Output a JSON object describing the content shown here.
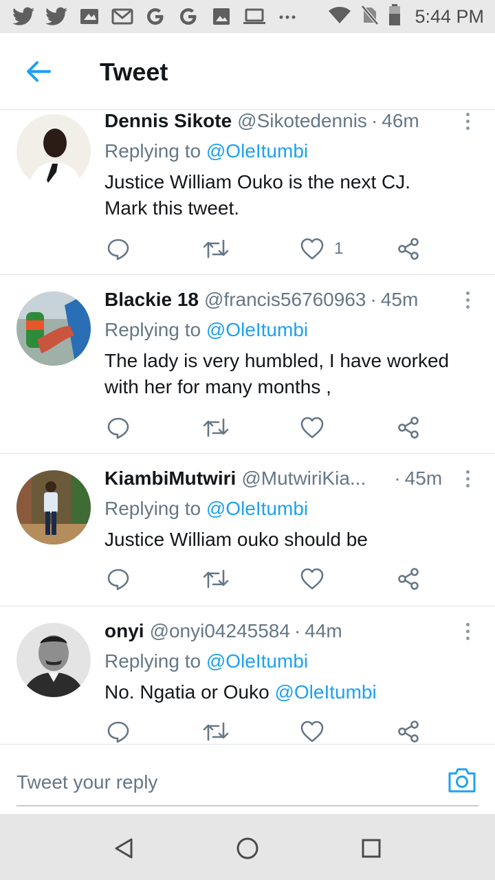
{
  "status_bar": {
    "time": "5:44 PM",
    "icons_left": [
      "twitter-icon",
      "twitter-icon",
      "news-icon",
      "gmail-icon",
      "google-icon",
      "google-icon",
      "image-icon",
      "laptop-icon",
      "more-notifications-icon"
    ],
    "icons_right": [
      "wifi-icon",
      "no-sim-icon",
      "battery-icon"
    ]
  },
  "header": {
    "title": "Tweet",
    "back_icon": "arrow-left-icon"
  },
  "colors": {
    "accent": "#1da1f2",
    "text": "#14171a",
    "secondary_text": "#657786",
    "divider": "#dfe3e6"
  },
  "tweets": [
    {
      "name": "Dennis Sikote",
      "handle": "@Sikotedennis",
      "separator": "·",
      "time": "46m",
      "replying_prefix": "Replying to",
      "replying_to": "@OleItumbi",
      "text_lines": [
        "Justice William Ouko is the next CJ.",
        "Mark this tweet."
      ],
      "mention_in_text": "",
      "like_count": "1"
    },
    {
      "name": "Blackie 18",
      "handle": "@francis56760963",
      "separator": "·",
      "time": "45m",
      "replying_prefix": "Replying to",
      "replying_to": "@OleItumbi",
      "text_lines": [
        "The lady is very humbled, I have worked",
        "with her for many months ,"
      ],
      "mention_in_text": "",
      "like_count": ""
    },
    {
      "name": "KiambiMutwiri",
      "handle": "@MutwiriKia...",
      "separator": "·",
      "time": "45m",
      "replying_prefix": "Replying to",
      "replying_to": "@OleItumbi",
      "text_lines": [
        "Justice William ouko should be"
      ],
      "mention_in_text": "",
      "like_count": ""
    },
    {
      "name": "onyi",
      "handle": "@onyi04245584",
      "separator": "·",
      "time": "44m",
      "replying_prefix": "Replying to",
      "replying_to": "@OleItumbi",
      "text_lines": [
        "No. Ngatia or Ouko "
      ],
      "mention_in_text": "@OleItumbi",
      "like_count": ""
    }
  ],
  "reply_bar": {
    "placeholder": "Tweet your reply",
    "camera_icon": "camera-icon"
  },
  "nav_bar": {
    "buttons": [
      "back-triangle-icon",
      "home-circle-icon",
      "recents-square-icon"
    ]
  }
}
